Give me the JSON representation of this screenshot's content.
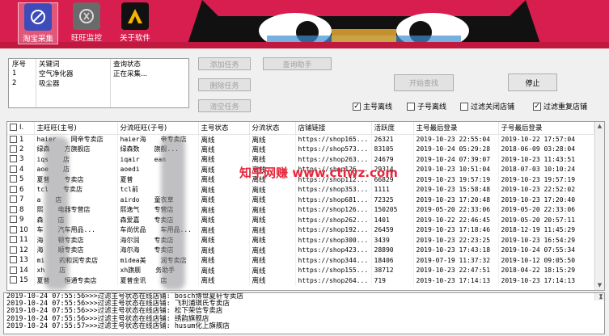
{
  "toolbar": {
    "buttons": [
      {
        "label": "淘宝采集",
        "icon": "taobao-collect-icon",
        "active": true
      },
      {
        "label": "旺旺监控",
        "icon": "wangwang-monitor-icon",
        "active": false
      },
      {
        "label": "关于软件",
        "icon": "about-icon",
        "active": false
      }
    ]
  },
  "tasks": {
    "headers": [
      "序号",
      "关键词",
      "查询状态"
    ],
    "rows": [
      [
        "1",
        "空气净化器",
        "正在采集..."
      ],
      [
        "2",
        "吸尘器",
        ""
      ]
    ]
  },
  "buttons": {
    "add_task": "添加任务",
    "delete_task": "删除任务",
    "clear_task": "清空任务",
    "query_assistant": "查询助手",
    "start_query": "开始查找",
    "stop": "停止"
  },
  "options": {
    "main_offline": {
      "label": "主号离线",
      "checked": true
    },
    "sub_offline": {
      "label": "子号离线",
      "checked": false
    },
    "filter_closed": {
      "label": "过滤关闭店铺",
      "checked": false
    },
    "filter_duplicate": {
      "label": "过滤重复店铺",
      "checked": true
    }
  },
  "results": {
    "headers": [
      "I.",
      "主旺旺(主号)",
      "分流旺旺(子号)",
      "主号状态",
      "分流状态",
      "店铺链接",
      "活跃度",
      "主号最后登录",
      "子号最后登录"
    ],
    "rows": [
      [
        "1",
        "haier",
        "网帝专卖店",
        "haier海",
        "帝专卖店",
        "离线",
        "离线",
        "https://shop165...",
        "26321",
        "2019-10-23 22:55:04",
        "2019-10-22 17:57:04"
      ],
      [
        "2",
        "绿森",
        "方旗舰店",
        "绿森数",
        "旗舰...",
        "离线",
        "离线",
        "https://shop573...",
        "83105",
        "2019-10-24 05:29:28",
        "2018-06-09 03:28:04"
      ],
      [
        "3",
        "iqs",
        "店",
        "iqair",
        "ean",
        "离线",
        "离线",
        "https://shop263...",
        "24679",
        "2019-10-24 07:39:07",
        "2019-10-23 11:43:51"
      ],
      [
        "4",
        "aoe",
        "店",
        "aoedi",
        "",
        "离线",
        "离线",
        "https://shop126...",
        "29314",
        "2019-10-23 10:51:04",
        "2018-07-03 10:10:24"
      ],
      [
        "5",
        "夏普",
        "专卖店",
        "夏普",
        "",
        "离线",
        "离线",
        "https://shop112...",
        "66829",
        "2019-10-23 19:57:19",
        "2019-10-23 19:57:19"
      ],
      [
        "6",
        "tcl",
        "专卖店",
        "tcl前",
        "",
        "离线",
        "离线",
        "https://shop353...",
        "1111",
        "2019-10-23 15:58:48",
        "2019-10-23 22:52:02"
      ],
      [
        "7",
        "a",
        "店",
        "airdo",
        "童衣草",
        "离线",
        "离线",
        "https://shop681...",
        "72325",
        "2019-10-23 17:20:48",
        "2019-10-23 17:20:40"
      ],
      [
        "8",
        "熙",
        "电器专营店",
        "熙逸气",
        "专营店",
        "离线",
        "离线",
        "https://shop126...",
        "150205",
        "2019-05-20 22:33:06",
        "2019-05-20 22:33:06"
      ],
      [
        "9",
        "森",
        "店",
        "森爱嘉",
        "专卖店",
        "离线",
        "离线",
        "https://shop262...",
        "1401",
        "2019-10-22 22:46:45",
        "2019-05-20 20:57:11"
      ],
      [
        "10",
        "车",
        "汽车用品...",
        "车尚优品",
        "车用品...",
        "离线",
        "离线",
        "https://shop192...",
        "26459",
        "2019-10-23 17:18:46",
        "2018-12-19 11:45:29"
      ],
      [
        "11",
        "海",
        "顿专卖店",
        "海尔润",
        "专卖店",
        "离线",
        "离线",
        "https://shop300...",
        "3439",
        "2019-10-23 22:23:25",
        "2019-10-23 16:54:29"
      ],
      [
        "12",
        "海",
        "顺专卖店",
        "海尔海",
        "专卖店",
        "离线",
        "离线",
        "https://shop423...",
        "28890",
        "2019-10-23 17:43:18",
        "2019-10-24 07:55:34"
      ],
      [
        "13",
        "mi",
        "的和润专卖店",
        "midea美",
        "润专卖店",
        "离线",
        "离线",
        "https://shop344...",
        "18406",
        "2019-07-19 11:37:32",
        "2019-10-12 09:05:50"
      ],
      [
        "14",
        "xh",
        "店",
        "xh旗舰",
        "务助手",
        "离线",
        "离线",
        "https://shop155...",
        "38712",
        "2019-10-23 22:47:51",
        "2018-04-22 18:15:29"
      ],
      [
        "15",
        "夏普",
        "恒通专卖店",
        "夏普金讯",
        "店",
        "离线",
        "离线",
        "https://shop264...",
        "719",
        "2019-10-23 17:14:13",
        "2019-10-23 17:14:13"
      ]
    ]
  },
  "watermark": "知乎网赚 www.ctiwz.com",
  "log": [
    "2019-10-24 07:55:56>>>过滤主号状态在线店铺: bosch博世夏轩专卖店",
    "2019-10-24 07:55:56>>>过滤主号状态在线店铺: 飞利浦琪氏专卖店",
    "2019-10-24 07:55:56>>>过滤主号状态在线店铺: 松下荣信专卖店",
    "2019-10-24 07:55:56>>>过滤主号状态在线店铺: 绣韵旗舰店",
    "2019-10-24 07:55:57>>>过滤主号状态在线店铺: husum化上旗舰店"
  ]
}
